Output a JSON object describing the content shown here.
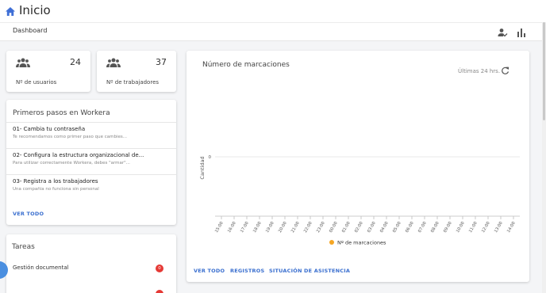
{
  "header": {
    "title": "Inicio",
    "home_icon": "home-icon",
    "accent": "#3f6fd6"
  },
  "subheader": {
    "breadcrumb": "Dashboard",
    "icons": [
      "person-check-icon",
      "bar-chart-icon"
    ]
  },
  "stats": [
    {
      "icon": "group-icon",
      "value": "24",
      "label": "Nº de usuarios"
    },
    {
      "icon": "group-icon",
      "value": "37",
      "label": "Nº de trabajadores"
    }
  ],
  "first_steps": {
    "title": "Primeros pasos en Workera",
    "items": [
      {
        "title": "01- Cambia tu contraseña",
        "subtitle": "Te recomendamos como primer paso que cambies..."
      },
      {
        "title": "02- Configura la estructura organizacional de...",
        "subtitle": "Para utilizar correctamente Workera, debes \"armar\"..."
      },
      {
        "title": "03- Registra a los trabajadores",
        "subtitle": "Una compañía no funciona sin personal"
      }
    ],
    "link": "VER TODO"
  },
  "tasks": {
    "title": "Tareas",
    "items": [
      {
        "label": "Gestión documental",
        "count": "0"
      }
    ],
    "badge_color": "#e53935"
  },
  "chart_card": {
    "title": "Número de marcaciones",
    "range_label": "Últimas 24 hrs.",
    "refresh_icon": "refresh-icon",
    "links": [
      "VER TODO",
      "REGISTROS",
      "SITUACIÓN DE ASISTENCIA"
    ]
  },
  "chart_data": {
    "type": "line",
    "ylabel": "Cantidad",
    "xlabel": "",
    "x": [
      "15:00",
      "16:00",
      "17:00",
      "18:00",
      "19:00",
      "20:00",
      "21:00",
      "22:00",
      "23:00",
      "00:00",
      "01:00",
      "02:00",
      "03:00",
      "04:00",
      "05:00",
      "06:00",
      "07:00",
      "08:00",
      "09:00",
      "10:00",
      "11:00",
      "12:00",
      "13:00",
      "14:00"
    ],
    "series": [
      {
        "name": "Nº de marcaciones",
        "color": "#f5a623",
        "values": [
          0,
          0,
          0,
          0,
          0,
          0,
          0,
          0,
          0,
          0,
          0,
          0,
          0,
          0,
          0,
          0,
          0,
          0,
          0,
          0,
          0,
          0,
          0,
          0
        ]
      }
    ],
    "yticks": [
      "0"
    ],
    "legend": "bottom",
    "grid": true
  }
}
